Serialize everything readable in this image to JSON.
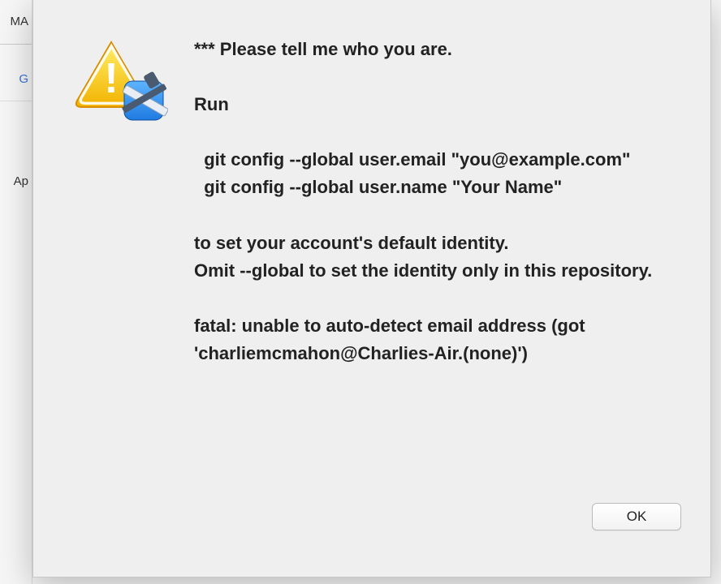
{
  "background": {
    "toolbar_fragment": "MA",
    "link_fragment": "G",
    "lower_fragment": "Ap"
  },
  "dialog": {
    "message": "*** Please tell me who you are.\n\nRun\n\n  git config --global user.email \"you@example.com\"\n  git config --global user.name \"Your Name\"\n\nto set your account's default identity.\nOmit --global to set the identity only in this repository.\n\nfatal: unable to auto-detect email address (got 'charliemcmahon@Charlies-Air.(none)')",
    "ok_label": "OK"
  }
}
